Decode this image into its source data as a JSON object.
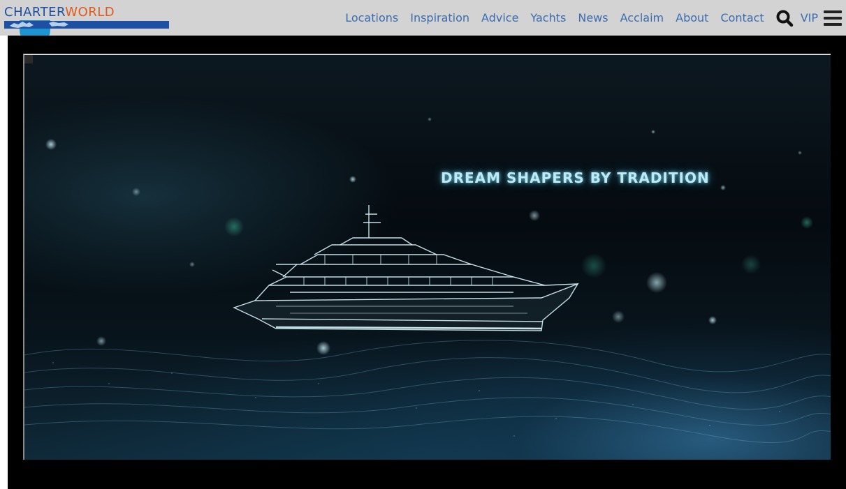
{
  "header": {
    "logo": {
      "part1": "CHARTER",
      "part2": "WORLD"
    },
    "nav_items": [
      {
        "label": "Locations"
      },
      {
        "label": "Inspiration"
      },
      {
        "label": "Advice"
      },
      {
        "label": "Yachts"
      },
      {
        "label": "News"
      },
      {
        "label": "Acclaim"
      },
      {
        "label": "About"
      },
      {
        "label": "Contact"
      }
    ],
    "search_icon": "search-icon",
    "vip_label": "VIP",
    "menu_icon": "hamburger-menu-icon"
  },
  "video": {
    "tagline": "DREAM SHAPERS BY TRADITION"
  },
  "colors": {
    "header_bg": "#d3d3d3",
    "nav_link": "#3a6db0",
    "logo_blue": "#1d4fa3",
    "logo_orange": "#e05a1e",
    "video_bg": "#000000"
  }
}
